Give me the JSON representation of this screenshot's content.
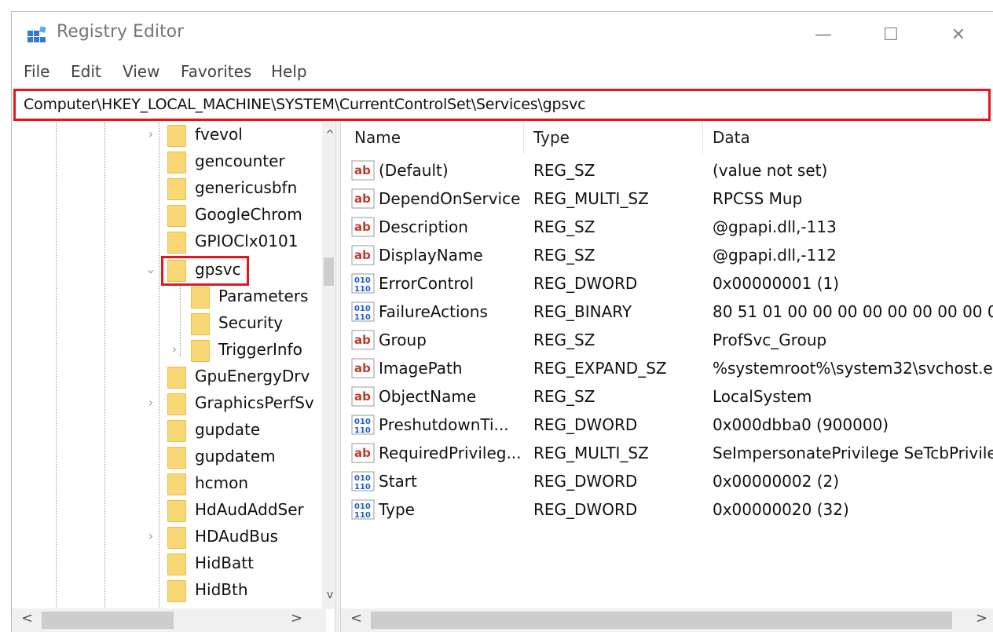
{
  "window": {
    "title": "Registry Editor",
    "controls": {
      "minimize": "—",
      "maximize": "☐",
      "close": "✕"
    }
  },
  "menu": [
    "File",
    "Edit",
    "View",
    "Favorites",
    "Help"
  ],
  "address": "Computer\\HKEY_LOCAL_MACHINE\\SYSTEM\\CurrentControlSet\\Services\\gpsvc",
  "tree": {
    "items": [
      {
        "label": "fvevol",
        "expander": "›"
      },
      {
        "label": "gencounter",
        "expander": ""
      },
      {
        "label": "genericusbfn",
        "expander": ""
      },
      {
        "label": "GoogleChrom",
        "expander": ""
      },
      {
        "label": "GPIOClx0101",
        "expander": ""
      },
      {
        "label": "gpsvc",
        "expander": "⌄",
        "selected": true
      },
      {
        "label": "Parameters",
        "expander": ""
      },
      {
        "label": "Security",
        "expander": ""
      },
      {
        "label": "TriggerInfo",
        "expander": "›"
      },
      {
        "label": "GpuEnergyDrv",
        "expander": ""
      },
      {
        "label": "GraphicsPerfSv",
        "expander": "›"
      },
      {
        "label": "gupdate",
        "expander": ""
      },
      {
        "label": "gupdatem",
        "expander": ""
      },
      {
        "label": "hcmon",
        "expander": ""
      },
      {
        "label": "HdAudAddSer",
        "expander": ""
      },
      {
        "label": "HDAudBus",
        "expander": "›"
      },
      {
        "label": "HidBatt",
        "expander": ""
      },
      {
        "label": "HidBth",
        "expander": ""
      }
    ],
    "scroll_up": "^",
    "scroll_down": "v"
  },
  "list": {
    "headers": {
      "name": "Name",
      "type": "Type",
      "data": "Data"
    },
    "rows": [
      {
        "icon": "string-value-icon",
        "name": "(Default)",
        "type": "REG_SZ",
        "data": "(value not set)"
      },
      {
        "icon": "string-value-icon",
        "name": "DependOnService",
        "type": "REG_MULTI_SZ",
        "data": "RPCSS Mup"
      },
      {
        "icon": "string-value-icon",
        "name": "Description",
        "type": "REG_SZ",
        "data": "@gpapi.dll,-113"
      },
      {
        "icon": "string-value-icon",
        "name": "DisplayName",
        "type": "REG_SZ",
        "data": "@gpapi.dll,-112"
      },
      {
        "icon": "binary-value-icon",
        "name": "ErrorControl",
        "type": "REG_DWORD",
        "data": "0x00000001 (1)"
      },
      {
        "icon": "binary-value-icon",
        "name": "FailureActions",
        "type": "REG_BINARY",
        "data": "80 51 01 00 00 00 00 00 00 00 00 00 0"
      },
      {
        "icon": "string-value-icon",
        "name": "Group",
        "type": "REG_SZ",
        "data": "ProfSvc_Group"
      },
      {
        "icon": "string-value-icon",
        "name": "ImagePath",
        "type": "REG_EXPAND_SZ",
        "data": "%systemroot%\\system32\\svchost.e"
      },
      {
        "icon": "string-value-icon",
        "name": "ObjectName",
        "type": "REG_SZ",
        "data": "LocalSystem"
      },
      {
        "icon": "binary-value-icon",
        "name": "PreshutdownTi...",
        "type": "REG_DWORD",
        "data": "0x000dbba0 (900000)"
      },
      {
        "icon": "string-value-icon",
        "name": "RequiredPrivileg...",
        "type": "REG_MULTI_SZ",
        "data": "SeImpersonatePrivilege SeTcbPrivile"
      },
      {
        "icon": "binary-value-icon",
        "name": "Start",
        "type": "REG_DWORD",
        "data": "0x00000002 (2)"
      },
      {
        "icon": "binary-value-icon",
        "name": "Type",
        "type": "REG_DWORD",
        "data": "0x00000020 (32)"
      }
    ]
  },
  "scroll": {
    "left_arrow": "<",
    "right_arrow": ">"
  },
  "colors": {
    "highlight": "#e8141b",
    "folder": "#f8d775"
  }
}
